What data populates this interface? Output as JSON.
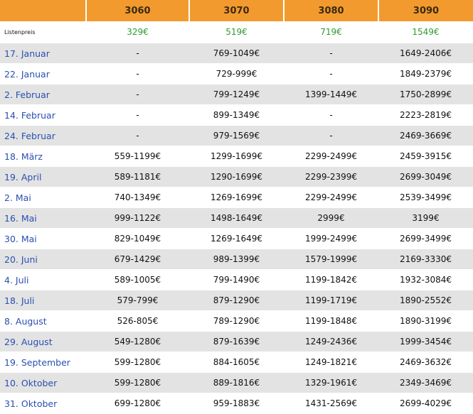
{
  "header": {
    "corner": "",
    "models": [
      "3060",
      "3070",
      "3080",
      "3090"
    ]
  },
  "list_price": {
    "label": "Listenpreis",
    "values": [
      "329€",
      "519€",
      "719€",
      "1549€"
    ]
  },
  "rows": [
    {
      "date": "17. Januar",
      "values": [
        "-",
        "769-1049€",
        "-",
        "1649-2406€"
      ]
    },
    {
      "date": "22. Januar",
      "values": [
        "-",
        "729-999€",
        "-",
        "1849-2379€"
      ]
    },
    {
      "date": "2. Februar",
      "values": [
        "-",
        "799-1249€",
        "1399-1449€",
        "1750-2899€"
      ]
    },
    {
      "date": "14. Februar",
      "values": [
        "-",
        "899-1349€",
        "-",
        "2223-2819€"
      ]
    },
    {
      "date": "24. Februar",
      "values": [
        "-",
        "979-1569€",
        "-",
        "2469-3669€"
      ]
    },
    {
      "date": "18. März",
      "values": [
        "559-1199€",
        "1299-1699€",
        "2299-2499€",
        "2459-3915€"
      ]
    },
    {
      "date": "19. April",
      "values": [
        "589-1181€",
        "1290-1699€",
        "2299-2399€",
        "2699-3049€"
      ]
    },
    {
      "date": "2. Mai",
      "values": [
        "740-1349€",
        "1269-1699€",
        "2299-2499€",
        "2539-3499€"
      ]
    },
    {
      "date": "16. Mai",
      "values": [
        "999-1122€",
        "1498-1649€",
        "2999€",
        "3199€"
      ]
    },
    {
      "date": "30. Mai",
      "values": [
        "829-1049€",
        "1269-1649€",
        "1999-2499€",
        "2699-3499€"
      ]
    },
    {
      "date": "20. Juni",
      "values": [
        "679-1429€",
        "989-1399€",
        "1579-1999€",
        "2169-3330€"
      ]
    },
    {
      "date": "4. Juli",
      "values": [
        "589-1005€",
        "799-1490€",
        "1199-1842€",
        "1932-3084€"
      ]
    },
    {
      "date": "18. Juli",
      "values": [
        "579-799€",
        "879-1290€",
        "1199-1719€",
        "1890-2552€"
      ]
    },
    {
      "date": "8. August",
      "values": [
        "526-805€",
        "789-1290€",
        "1199-1848€",
        "1890-3199€"
      ]
    },
    {
      "date": "29. August",
      "values": [
        "549-1280€",
        "879-1639€",
        "1249-2436€",
        "1999-3454€"
      ]
    },
    {
      "date": "19. September",
      "values": [
        "599-1280€",
        "884-1605€",
        "1249-1821€",
        "2469-3632€"
      ]
    },
    {
      "date": "10. Oktober",
      "values": [
        "599-1280€",
        "889-1816€",
        "1329-1961€",
        "2349-3469€"
      ]
    },
    {
      "date": "31. Oktober",
      "values": [
        "699-1280€",
        "959-1883€",
        "1431-2569€",
        "2699-4029€"
      ]
    }
  ]
}
